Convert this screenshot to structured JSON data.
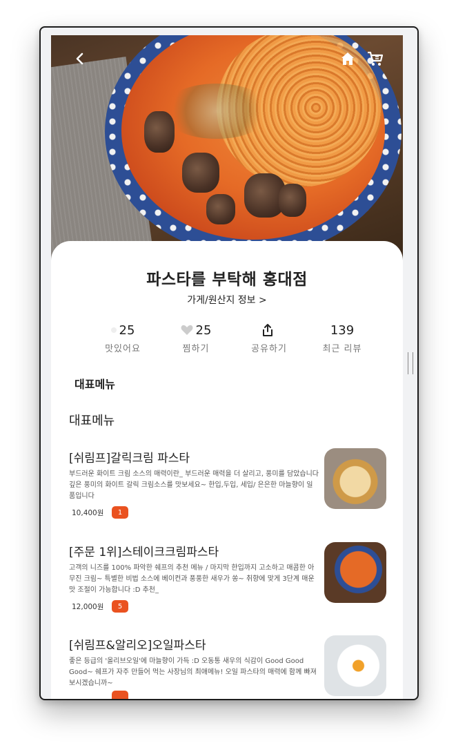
{
  "store": {
    "name": "파스타를 부탁해 홍대점",
    "info_link": "가게/원산지 정보 >"
  },
  "stats": [
    {
      "icon": "dot-icon",
      "value": "25",
      "label": "맛있어요"
    },
    {
      "icon": "heart-icon",
      "value": "25",
      "label": "찜하기"
    },
    {
      "icon": "share-icon",
      "value": "",
      "label": "공유하기"
    },
    {
      "icon": "",
      "value": "139",
      "label": "최근 리뷰"
    }
  ],
  "sections": {
    "featured_heading": "대표메뉴",
    "menu_heading": "대표메뉴"
  },
  "menu": [
    {
      "name": "[쉬림프]갈릭크림 파스타",
      "description": "부드러운 화이트 크림 소스의 매력이란_ 부드러운 매력을 더 살리고, 풍미를 담았습니다 깊은 풍미의 화이트 갈릭 크림소스를 맛보세요~ 한입,두입, 세입/ 은은한 마늘향이 일품입니다",
      "price": "10,400원",
      "badge": "1"
    },
    {
      "name": "[주문 1위]스테이크크림파스타",
      "description": "고객의 니즈를 100% 파악한 쉐프의 추천 메뉴 / 마지막 한입까지 고소하고 매콤한 아무진 크림~ 특별한 비법 소스에 베이컨과 풍풍한 새우가 쏭~ 취향에 맞게 3단계 매운맛 조절이 가능합니다 :D 추천_",
      "price": "12,000원",
      "badge": "5"
    },
    {
      "name": "[쉬림프&알리오]오일파스타",
      "description": "좋은 등급의 '올리브오일'에 마늘향이 가득 :D 오동통 새우의 식감이 Good Good Good~ 쉐프가 자주 만들어 먹는 사장님의 최애메뉴! 오일 파스타의 매력에 함께 빠져보시겠습니까~",
      "price": "",
      "badge": ""
    }
  ],
  "colors": {
    "accent": "#ea5220",
    "heart": "#cccccc"
  }
}
